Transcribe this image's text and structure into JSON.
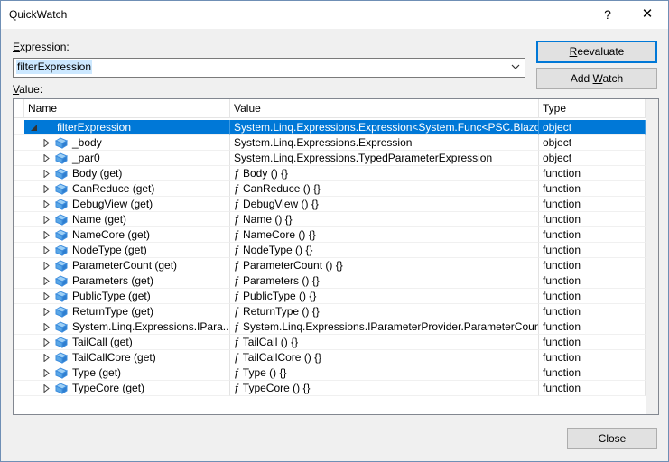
{
  "window": {
    "title": "QuickWatch",
    "help_glyph": "?",
    "close_glyph": "✕"
  },
  "expression": {
    "label_prefix": "",
    "label_mnemonic": "E",
    "label_rest": "xpression:",
    "value": "filterExpression"
  },
  "value_label": {
    "mnemonic": "V",
    "rest": "alue:"
  },
  "buttons": {
    "reevaluate_mnemonic": "R",
    "reevaluate_rest": "eevaluate",
    "add_watch_prefix": "Add ",
    "add_watch_mnemonic": "W",
    "add_watch_rest": "atch",
    "close": "Close"
  },
  "columns": [
    "Name",
    "Value",
    "Type"
  ],
  "rows": [
    {
      "name": "filterExpression",
      "value": "System.Linq.Expressions.Expression<System.Func<PSC.Blazor...",
      "type": "object",
      "level": 0,
      "expanded": true,
      "selected": true
    },
    {
      "name": "_body",
      "value": "System.Linq.Expressions.Expression",
      "type": "object",
      "level": 1
    },
    {
      "name": "_par0",
      "value": "System.Linq.Expressions.TypedParameterExpression",
      "type": "object",
      "level": 1
    },
    {
      "name": "Body (get)",
      "value": "ƒ Body () {}",
      "type": "function",
      "level": 1
    },
    {
      "name": "CanReduce (get)",
      "value": "ƒ CanReduce () {}",
      "type": "function",
      "level": 1
    },
    {
      "name": "DebugView (get)",
      "value": "ƒ DebugView () {}",
      "type": "function",
      "level": 1
    },
    {
      "name": "Name (get)",
      "value": "ƒ Name () {}",
      "type": "function",
      "level": 1
    },
    {
      "name": "NameCore (get)",
      "value": "ƒ NameCore () {}",
      "type": "function",
      "level": 1
    },
    {
      "name": "NodeType (get)",
      "value": "ƒ NodeType () {}",
      "type": "function",
      "level": 1
    },
    {
      "name": "ParameterCount (get)",
      "value": "ƒ ParameterCount () {}",
      "type": "function",
      "level": 1
    },
    {
      "name": "Parameters (get)",
      "value": "ƒ Parameters () {}",
      "type": "function",
      "level": 1
    },
    {
      "name": "PublicType (get)",
      "value": "ƒ PublicType () {}",
      "type": "function",
      "level": 1
    },
    {
      "name": "ReturnType (get)",
      "value": "ƒ ReturnType () {}",
      "type": "function",
      "level": 1
    },
    {
      "name": "System.Linq.Expressions.IPara...",
      "value": "ƒ System.Linq.Expressions.IParameterProvider.ParameterCoun...",
      "type": "function",
      "level": 1
    },
    {
      "name": "TailCall (get)",
      "value": "ƒ TailCall () {}",
      "type": "function",
      "level": 1
    },
    {
      "name": "TailCallCore (get)",
      "value": "ƒ TailCallCore () {}",
      "type": "function",
      "level": 1
    },
    {
      "name": "Type (get)",
      "value": "ƒ Type () {}",
      "type": "function",
      "level": 1
    },
    {
      "name": "TypeCore (get)",
      "value": "ƒ TypeCore () {}",
      "type": "function",
      "level": 1
    }
  ],
  "colors": {
    "selection": "#0078d7",
    "object_icon": "#3c8dde",
    "button_face": "#e1e1e1",
    "dialog_bg": "#f0f0f0"
  }
}
